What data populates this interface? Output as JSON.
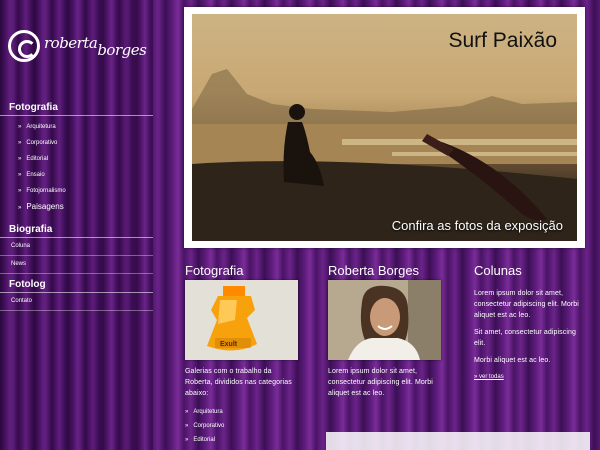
{
  "logo": {
    "line1": "roberta",
    "line2": "borges"
  },
  "nav": {
    "fotografia": {
      "title": "Fotografia",
      "items": [
        "Arquitetura",
        "Corporativo",
        "Editorial",
        "Ensaio",
        "Fotojornalismo",
        "Paisagens"
      ]
    },
    "biografia": {
      "title": "Biografia",
      "items": [
        "Coluna",
        "News"
      ]
    },
    "fotolog": {
      "title": "Fotolog",
      "items": [
        "Contato"
      ]
    }
  },
  "hero": {
    "title": "Surf Paixão",
    "caption": "Confira as fotos da exposição"
  },
  "columns": {
    "fotografia": {
      "title": "Fotografia",
      "product_label": "Exult",
      "text": "Galerias com o trabalho da Roberta, divididos nas categorias abaixo:",
      "links": [
        "Arquitetura",
        "Corporativo",
        "Editorial"
      ]
    },
    "roberta": {
      "title": "Roberta Borges",
      "text": "Lorem ipsum dolor sit amet, consectetur adipiscing elit. Morbi aliquet est ac leo."
    },
    "colunas": {
      "title": "Colunas",
      "p1": "Lorem ipsum dolor sit amet, consectetur adipiscing elit. Morbi aliquet est ac leo.",
      "p2": "Sit amet, consectetur adipiscing elit.",
      "p3": "Morbi aliquet est ac leo.",
      "more": "ver todas"
    }
  }
}
